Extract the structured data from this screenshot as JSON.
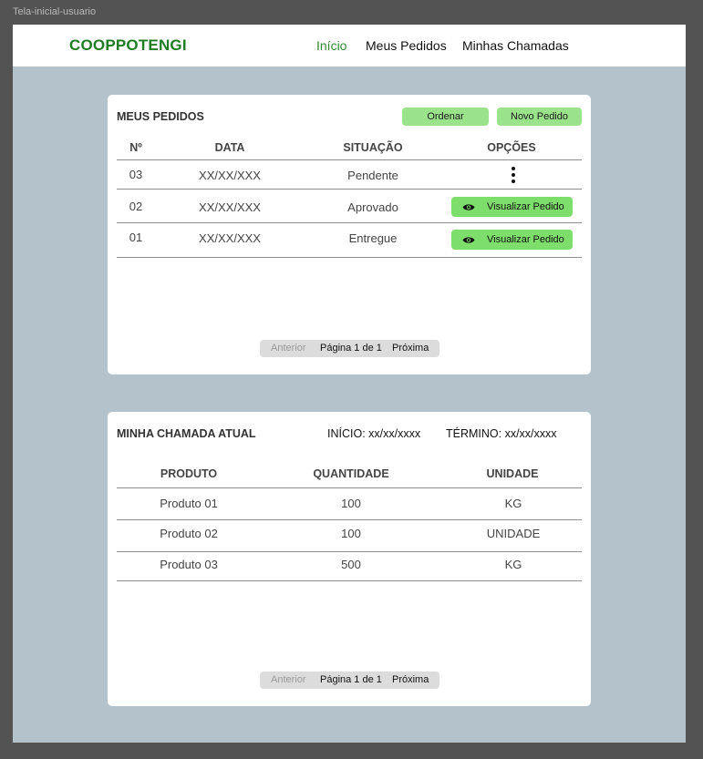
{
  "frame_label": "Tela-inicial-usuario",
  "navbar": {
    "brand": "COOPPOTENGI",
    "items": [
      "Início",
      "Meus Pedidos",
      "Minhas Chamadas"
    ],
    "active_color": "#2f8a2f"
  },
  "orders": {
    "title": "MEUS PEDIDOS",
    "sort_label": "Ordenar",
    "new_label": "Novo Pedido",
    "columns": [
      "Nº",
      "DATA",
      "SITUAÇÃO",
      "OPÇÕES"
    ],
    "rows": [
      {
        "num": "03",
        "date": "XX/XX/XXX",
        "status": "Pendente",
        "action": "more-options"
      },
      {
        "num": "02",
        "date": "XX/XX/XXX",
        "status": "Aprovado",
        "action": "Visualizar Pedido"
      },
      {
        "num": "01",
        "date": "XX/XX/XXX",
        "status": "Entregue",
        "action": "Visualizar Pedido"
      }
    ],
    "pager": {
      "prev": "Anterior",
      "page": "Página 1 de 1",
      "next": "Próxima"
    }
  },
  "call": {
    "title": "MINHA CHAMADA ATUAL",
    "start": "INÍCIO: xx/xx/xxxx",
    "end": "TÉRMINO: xx/xx/xxxx",
    "columns": [
      "PRODUTO",
      "QUANTIDADE",
      "UNIDADE"
    ],
    "rows": [
      {
        "product": "Produto 01",
        "qty": "100",
        "unit": "KG"
      },
      {
        "product": "Produto 02",
        "qty": "100",
        "unit": "UNIDADE"
      },
      {
        "product": "Produto 03",
        "qty": "500",
        "unit": "KG"
      }
    ],
    "pager": {
      "prev": "Anterior",
      "page": "Página 1 de 1",
      "next": "Próxima"
    }
  },
  "colors": {
    "brand_green": "#1e7d22",
    "button_light_green": "#9be38a",
    "button_green": "#7ede6c",
    "frame_bg": "#b4c2cb"
  }
}
